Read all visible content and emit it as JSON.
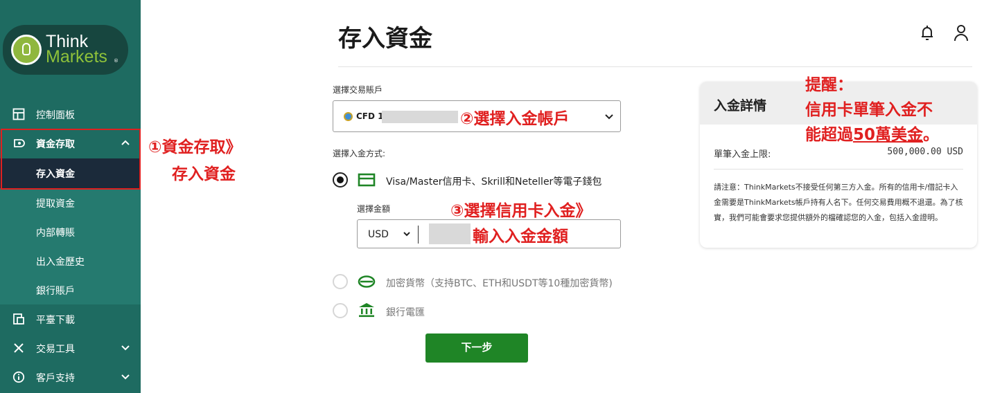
{
  "brand": {
    "logo_line1": "Think",
    "logo_line2": "Markets",
    "logo_reg": "®"
  },
  "sidebar": {
    "items": [
      {
        "label": "控制面板",
        "icon": "dashboard-icon"
      },
      {
        "label": "資金存取",
        "icon": "wallet-icon",
        "expanded": true
      },
      {
        "label": "存入資金",
        "active": true
      },
      {
        "label": "提取資金"
      },
      {
        "label": "内部轉賬"
      },
      {
        "label": "出入金歷史"
      },
      {
        "label": "銀行賬戶"
      },
      {
        "label": "平臺下載",
        "icon": "download-device-icon"
      },
      {
        "label": "交易工具",
        "icon": "tools-icon"
      },
      {
        "label": "客戶支持",
        "icon": "info-icon"
      }
    ]
  },
  "header": {
    "title": "存入資金"
  },
  "form": {
    "account_label": "選擇交易賬戶",
    "account_value": "CFD 1",
    "method_label": "選擇入金方式:",
    "methods": [
      {
        "label": "Visa/Master信用卡、Skrill和Neteller等電子錢包",
        "selected": true,
        "icon": "card-icon"
      },
      {
        "label": "加密貨幣（支持BTC、ETH和USDT等10種加密貨幣)",
        "selected": false,
        "icon": "coin-icon"
      },
      {
        "label": "銀行電匯",
        "selected": false,
        "icon": "bank-icon"
      }
    ],
    "amount_label": "選擇金額",
    "currency": "USD",
    "next_button": "下一步"
  },
  "details_card": {
    "title": "入金詳情",
    "limit_label": "單筆入金上限:",
    "limit_value": "500,000.00 USD",
    "note": "請注意：ThinkMarkets不接受任何第三方入金。所有的信用卡/借記卡入金需要是ThinkMarkets帳戶持有人名下。任何交易費用概不退還。為了核實，我們可能會要求您提供額外的檔確認您的入金，包括入金證明。"
  },
  "annotations": {
    "step1_line1": "①資金存取》",
    "step1_line2": "存入資金",
    "step2": "②選擇入金帳戶",
    "step3": "③選擇信用卡入金》",
    "step3_sub": "輸入入金金額",
    "reminder_title": "提醒：",
    "reminder_line1": "信用卡單筆入金不",
    "reminder_line2_prefix": "能超過",
    "reminder_line2_underlined": "50萬美金",
    "reminder_line2_suffix": "。"
  },
  "colors": {
    "sidebar": "#1e6b61",
    "active": "#1b2a3a",
    "accent_green": "#1f8526",
    "annotation_red": "#e02020"
  }
}
